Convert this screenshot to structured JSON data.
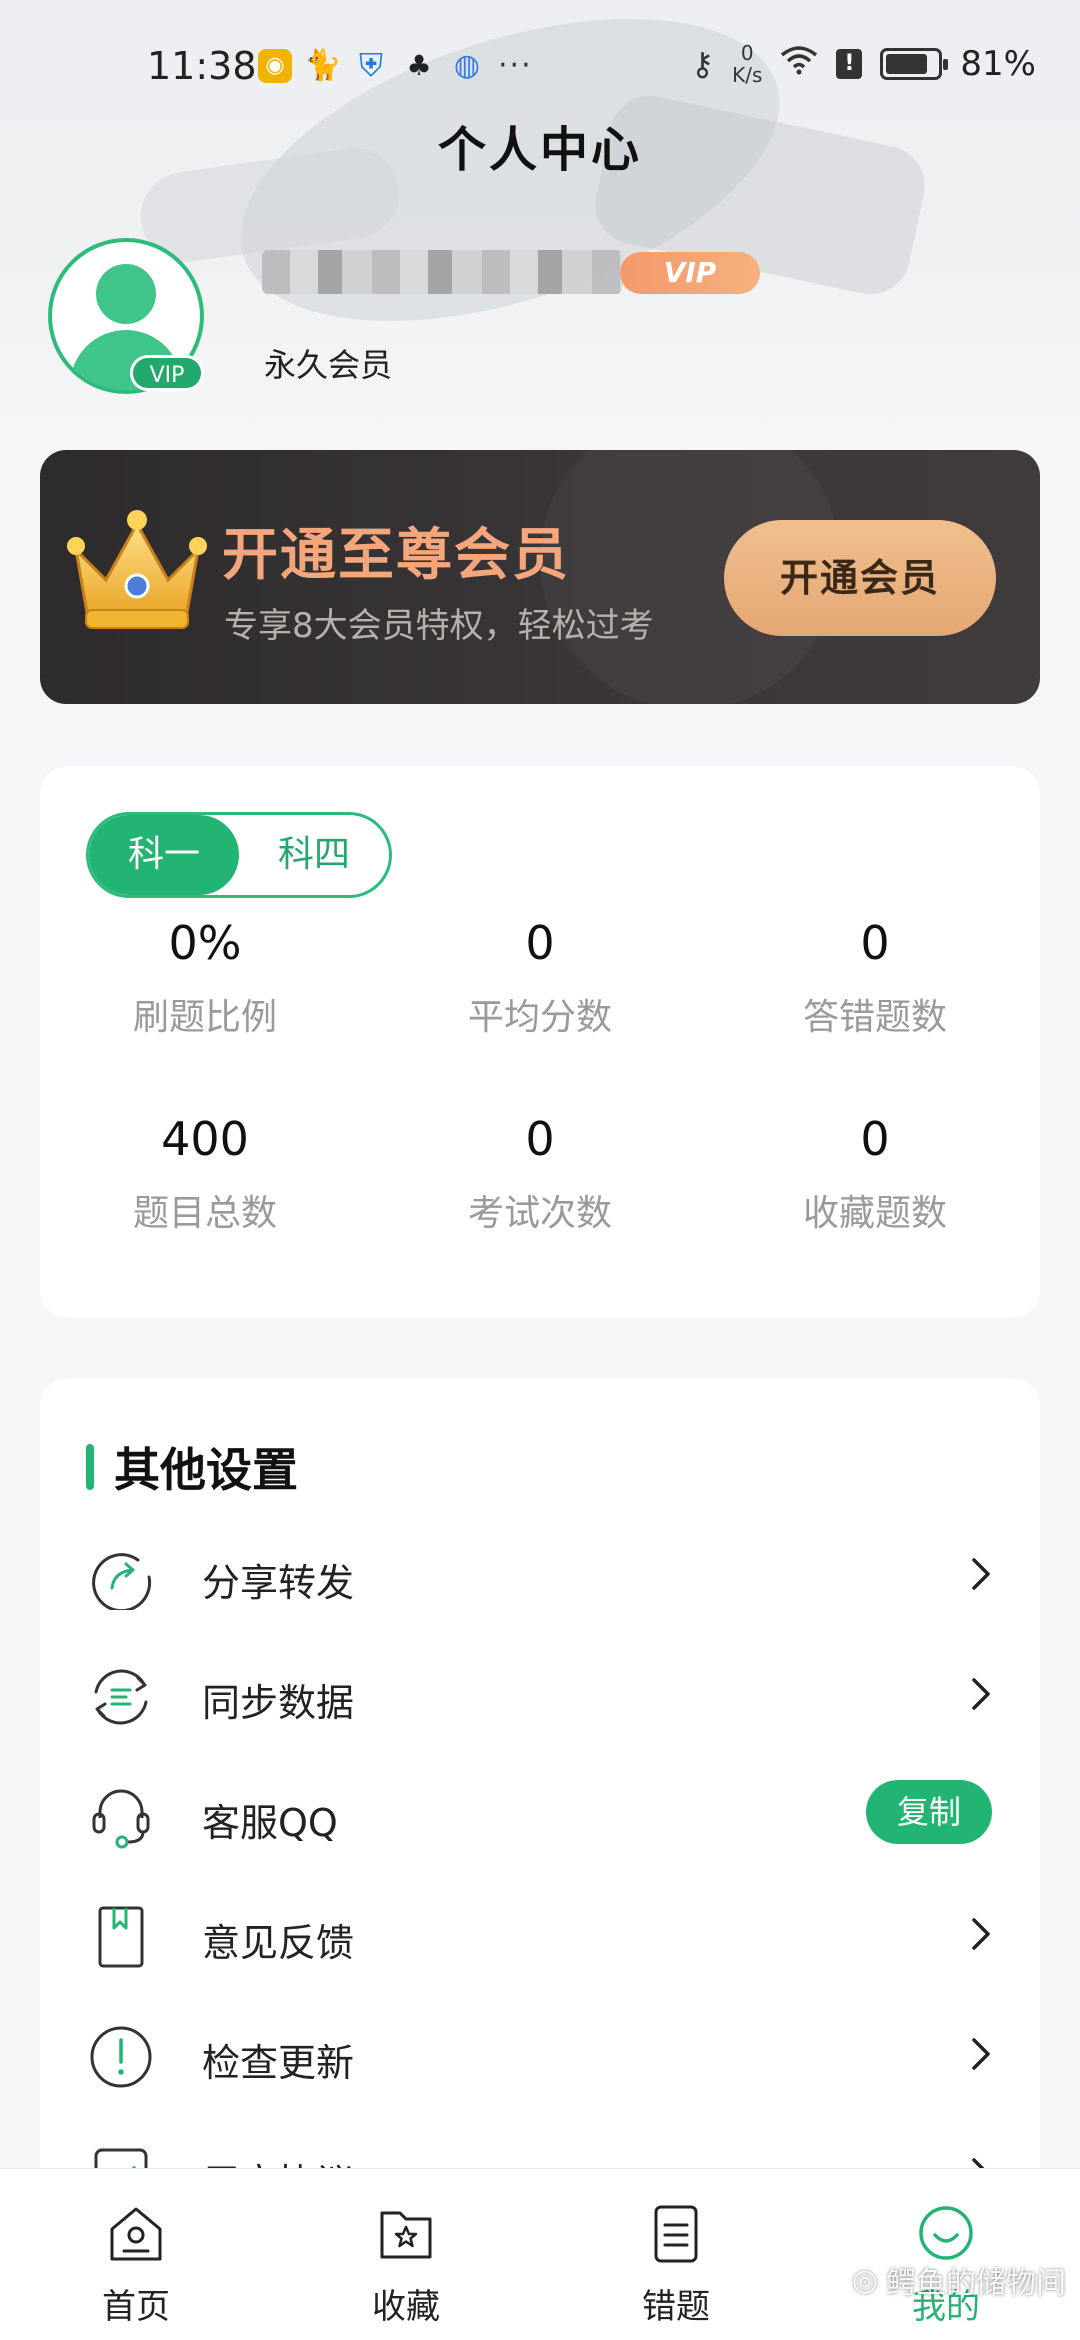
{
  "status_bar": {
    "time": "11:38",
    "net_speed_value": "0",
    "net_speed_unit": "K/s",
    "battery_percent": "81%",
    "battery_level": 0.81,
    "icons": [
      "weibo-icon",
      "cat-icon",
      "shield-icon",
      "cherry-icon",
      "globe-icon",
      "more-dots-icon",
      "key-icon",
      "wifi-icon",
      "alert-icon",
      "battery-icon"
    ]
  },
  "header": {
    "title": "个人中心"
  },
  "profile": {
    "avatar_badge": "VIP",
    "name_badge": "VIP",
    "member_type": "永久会员"
  },
  "vip_banner": {
    "title": "开通至尊会员",
    "subtitle": "专享8大会员特权，轻松过考",
    "button_label": "开通会员"
  },
  "stats": {
    "tabs": [
      {
        "label": "科一",
        "active": true
      },
      {
        "label": "科四",
        "active": false
      }
    ],
    "items": [
      {
        "value": "0%",
        "label": "刷题比例"
      },
      {
        "value": "0",
        "label": "平均分数"
      },
      {
        "value": "0",
        "label": "答错题数"
      },
      {
        "value": "400",
        "label": "题目总数"
      },
      {
        "value": "0",
        "label": "考试次数"
      },
      {
        "value": "0",
        "label": "收藏题数"
      }
    ]
  },
  "settings": {
    "title": "其他设置",
    "items": [
      {
        "label": "分享转发",
        "icon": "share-icon",
        "action": "chevron"
      },
      {
        "label": "同步数据",
        "icon": "sync-icon",
        "action": "chevron"
      },
      {
        "label": "客服QQ",
        "icon": "headset-icon",
        "action": "copy"
      },
      {
        "label": "意见反馈",
        "icon": "bookmark-book-icon",
        "action": "chevron"
      },
      {
        "label": "检查更新",
        "icon": "exclamation-icon",
        "action": "chevron"
      },
      {
        "label": "用户协议",
        "icon": "check-doc-icon",
        "action": "chevron"
      }
    ],
    "copy_label": "复制"
  },
  "bottom_nav": {
    "items": [
      {
        "label": "首页",
        "icon": "home-icon",
        "active": false
      },
      {
        "label": "收藏",
        "icon": "star-folder-icon",
        "active": false
      },
      {
        "label": "错题",
        "icon": "list-doc-icon",
        "active": false
      },
      {
        "label": "我的",
        "icon": "smile-icon",
        "active": true
      }
    ]
  },
  "watermark": "鳄鱼的储物间",
  "colors": {
    "accent": "#22b473",
    "banner_bg": "#2e2b2c",
    "banner_title": "#f4a77c",
    "banner_button": "#e9b27f"
  }
}
